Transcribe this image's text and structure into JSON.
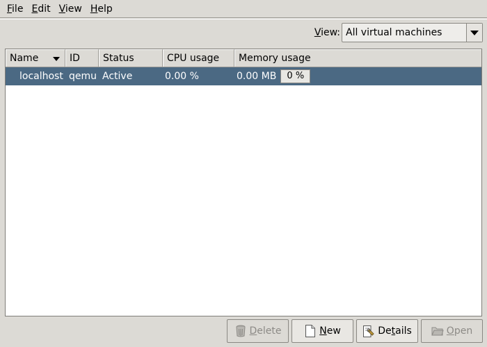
{
  "menu": [
    {
      "label": "File",
      "mnemonic": "F",
      "rest": "ile"
    },
    {
      "label": "Edit",
      "mnemonic": "E",
      "rest": "dit"
    },
    {
      "label": "View",
      "mnemonic": "V",
      "rest": "iew"
    },
    {
      "label": "Help",
      "mnemonic": "H",
      "rest": "elp"
    }
  ],
  "view_filter": {
    "label_mnemonic": "V",
    "label_rest": "iew:",
    "selected": "All virtual machines"
  },
  "table": {
    "columns": [
      "Name",
      "ID",
      "Status",
      "CPU usage",
      "Memory usage"
    ],
    "sort_column": "Name",
    "rows": [
      {
        "name": "localhost",
        "id": "qemu",
        "status": "Active",
        "cpu": "0.00 %",
        "memory": "0.00 MB",
        "memory_percent_label": "0 %"
      }
    ]
  },
  "buttons": {
    "delete": {
      "mnemonic": "D",
      "rest": "elete",
      "enabled": false,
      "icon": "trash-icon"
    },
    "new": {
      "mnemonic": "N",
      "rest": "ew",
      "enabled": true,
      "icon": "document-icon"
    },
    "details": {
      "pre": "De",
      "mnemonic": "t",
      "rest": "ails",
      "enabled": true,
      "icon": "properties-icon"
    },
    "open": {
      "mnemonic": "O",
      "rest": "pen",
      "enabled": false,
      "icon": "folder-icon"
    }
  },
  "colors": {
    "selection": "#4b6983",
    "window_bg": "#dcdad5"
  }
}
